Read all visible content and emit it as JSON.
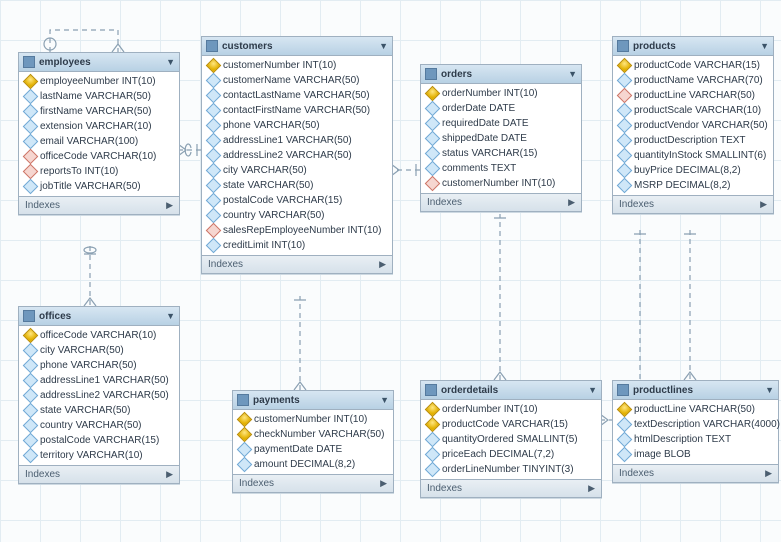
{
  "tables": {
    "employees": {
      "title": "employees",
      "columns": [
        {
          "ico": "pk",
          "label": "employeeNumber INT(10)"
        },
        {
          "ico": "attr",
          "label": "lastName VARCHAR(50)"
        },
        {
          "ico": "attr",
          "label": "firstName VARCHAR(50)"
        },
        {
          "ico": "attr",
          "label": "extension VARCHAR(10)"
        },
        {
          "ico": "attr",
          "label": "email VARCHAR(100)"
        },
        {
          "ico": "fk",
          "label": "officeCode VARCHAR(10)"
        },
        {
          "ico": "fk",
          "label": "reportsTo INT(10)"
        },
        {
          "ico": "attr",
          "label": "jobTitle VARCHAR(50)"
        }
      ],
      "indexes": "Indexes"
    },
    "offices": {
      "title": "offices",
      "columns": [
        {
          "ico": "pk",
          "label": "officeCode VARCHAR(10)"
        },
        {
          "ico": "attr",
          "label": "city VARCHAR(50)"
        },
        {
          "ico": "attr",
          "label": "phone VARCHAR(50)"
        },
        {
          "ico": "attr",
          "label": "addressLine1 VARCHAR(50)"
        },
        {
          "ico": "attr",
          "label": "addressLine2 VARCHAR(50)"
        },
        {
          "ico": "attr",
          "label": "state VARCHAR(50)"
        },
        {
          "ico": "attr",
          "label": "country VARCHAR(50)"
        },
        {
          "ico": "attr",
          "label": "postalCode VARCHAR(15)"
        },
        {
          "ico": "attr",
          "label": "territory VARCHAR(10)"
        }
      ],
      "indexes": "Indexes"
    },
    "customers": {
      "title": "customers",
      "columns": [
        {
          "ico": "pk",
          "label": "customerNumber INT(10)"
        },
        {
          "ico": "attr",
          "label": "customerName VARCHAR(50)"
        },
        {
          "ico": "attr",
          "label": "contactLastName VARCHAR(50)"
        },
        {
          "ico": "attr",
          "label": "contactFirstName VARCHAR(50)"
        },
        {
          "ico": "attr",
          "label": "phone VARCHAR(50)"
        },
        {
          "ico": "attr",
          "label": "addressLine1 VARCHAR(50)"
        },
        {
          "ico": "attr",
          "label": "addressLine2 VARCHAR(50)"
        },
        {
          "ico": "attr",
          "label": "city VARCHAR(50)"
        },
        {
          "ico": "attr",
          "label": "state VARCHAR(50)"
        },
        {
          "ico": "attr",
          "label": "postalCode VARCHAR(15)"
        },
        {
          "ico": "attr",
          "label": "country VARCHAR(50)"
        },
        {
          "ico": "fk",
          "label": "salesRepEmployeeNumber INT(10)"
        },
        {
          "ico": "attr",
          "label": "creditLimit INT(10)"
        }
      ],
      "indexes": "Indexes"
    },
    "payments": {
      "title": "payments",
      "columns": [
        {
          "ico": "pk",
          "label": "customerNumber INT(10)"
        },
        {
          "ico": "pk",
          "label": "checkNumber VARCHAR(50)"
        },
        {
          "ico": "attr",
          "label": "paymentDate DATE"
        },
        {
          "ico": "attr",
          "label": "amount DECIMAL(8,2)"
        }
      ],
      "indexes": "Indexes"
    },
    "orders": {
      "title": "orders",
      "columns": [
        {
          "ico": "pk",
          "label": "orderNumber INT(10)"
        },
        {
          "ico": "attr",
          "label": "orderDate DATE"
        },
        {
          "ico": "attr",
          "label": "requiredDate DATE"
        },
        {
          "ico": "attr",
          "label": "shippedDate DATE"
        },
        {
          "ico": "attr",
          "label": "status VARCHAR(15)"
        },
        {
          "ico": "attr",
          "label": "comments TEXT"
        },
        {
          "ico": "fk",
          "label": "customerNumber INT(10)"
        }
      ],
      "indexes": "Indexes"
    },
    "orderdetails": {
      "title": "orderdetails",
      "columns": [
        {
          "ico": "pk",
          "label": "orderNumber INT(10)"
        },
        {
          "ico": "pk",
          "label": "productCode VARCHAR(15)"
        },
        {
          "ico": "attr",
          "label": "quantityOrdered SMALLINT(5)"
        },
        {
          "ico": "attr",
          "label": "priceEach DECIMAL(7,2)"
        },
        {
          "ico": "attr",
          "label": "orderLineNumber TINYINT(3)"
        }
      ],
      "indexes": "Indexes"
    },
    "products": {
      "title": "products",
      "columns": [
        {
          "ico": "pk",
          "label": "productCode VARCHAR(15)"
        },
        {
          "ico": "attr",
          "label": "productName VARCHAR(70)"
        },
        {
          "ico": "fk",
          "label": "productLine VARCHAR(50)"
        },
        {
          "ico": "attr",
          "label": "productScale VARCHAR(10)"
        },
        {
          "ico": "attr",
          "label": "productVendor VARCHAR(50)"
        },
        {
          "ico": "attr",
          "label": "productDescription TEXT"
        },
        {
          "ico": "attr",
          "label": "quantityInStock SMALLINT(6)"
        },
        {
          "ico": "attr",
          "label": "buyPrice DECIMAL(8,2)"
        },
        {
          "ico": "attr",
          "label": "MSRP DECIMAL(8,2)"
        }
      ],
      "indexes": "Indexes"
    },
    "productlines": {
      "title": "productlines",
      "columns": [
        {
          "ico": "pk",
          "label": "productLine VARCHAR(50)"
        },
        {
          "ico": "attr",
          "label": "textDescription VARCHAR(4000)"
        },
        {
          "ico": "attr",
          "label": "htmlDescription TEXT"
        },
        {
          "ico": "attr",
          "label": "image BLOB"
        }
      ],
      "indexes": "Indexes"
    }
  },
  "relationships": [
    {
      "from": "employees.reportsTo",
      "to": "employees.employeeNumber",
      "type": "self"
    },
    {
      "from": "employees.officeCode",
      "to": "offices.officeCode"
    },
    {
      "from": "customers.salesRepEmployeeNumber",
      "to": "employees.employeeNumber"
    },
    {
      "from": "payments.customerNumber",
      "to": "customers.customerNumber"
    },
    {
      "from": "orders.customerNumber",
      "to": "customers.customerNumber"
    },
    {
      "from": "orderdetails.orderNumber",
      "to": "orders.orderNumber"
    },
    {
      "from": "orderdetails.productCode",
      "to": "products.productCode"
    },
    {
      "from": "products.productLine",
      "to": "productlines.productLine"
    }
  ]
}
